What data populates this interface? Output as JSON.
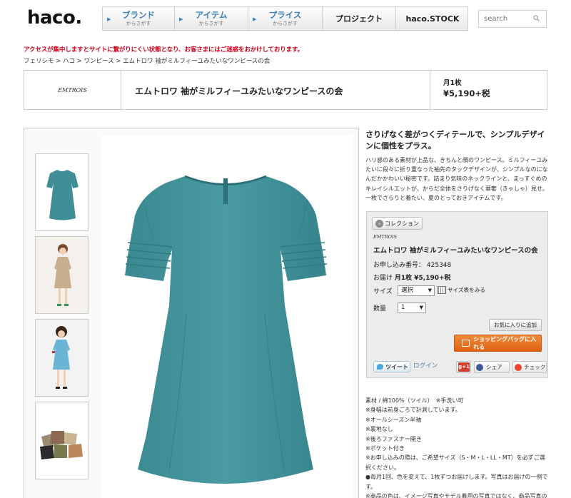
{
  "header": {
    "logo": "haco.",
    "nav": [
      {
        "label": "ブランド",
        "sub": "からさがす"
      },
      {
        "label": "アイテム",
        "sub": "からさがす"
      },
      {
        "label": "プライス",
        "sub": "からさがす"
      },
      {
        "label": "プロジェクト",
        "sub": ""
      },
      {
        "label": "haco.STOCK",
        "sub": ""
      }
    ],
    "search_placeholder": "search"
  },
  "notice": "アクセスが集中しますとサイトに繋がりにくい状態となり、お客さまにはご迷惑をおかけしております。",
  "breadcrumb": "フェリシモ > ハコ > ワンピース > エムトロワ 袖がミルフィーユみたいなワンピースの会",
  "product": {
    "brand": "EMTROIS",
    "name": "エムトロワ 袖がミルフィーユみたいなワンピースの会",
    "frequency": "月1枚",
    "price": "¥5,190+税"
  },
  "catch_copy": "さりげなく差がつくディテールで、シンプルデザインに個性をプラス。",
  "description": "ハリ感のある素材が上品な、きちんと顔のワンピース。ミルフィーユみたいに段々に折り重なった袖先のタックデザインが、シンプルなのになんだかかわいい秘密です。詰まり気味のネックラインと、まっすぐめのキレイシルエットが、からだ全体をさりげなく華奢（きゃしゃ）見せ。一枚でさらりと着たい、夏のとっておきアイテムです。",
  "cart": {
    "collection_label": "コレクション",
    "brand": "EMTROIS",
    "name": "エムトロワ 袖がミルフィーユみたいなワンピースの会",
    "order_no_label": "お申し込み番号：",
    "order_no": "425348",
    "delivery_label": "お届け",
    "delivery_value": "月1枚 ¥5,190+税",
    "size_label": "サイズ",
    "size_value": "選択",
    "size_guide": "サイズ表をみる",
    "qty_label": "数量",
    "qty_value": "1",
    "fav_button": "お気に入りに追加",
    "cart_button": "ショッピングバッグに入れる",
    "tweet": "ツイート",
    "login": "ログイン",
    "gplus": "g+1",
    "share": "シェア",
    "check": "チェック"
  },
  "specs": [
    "素材 / 綿100%（ツイル）　※手洗い可",
    "※身幅は前身ごろで計測しています。",
    "※オールシーズン半袖",
    "※裏地なし",
    "※後ろファスナー開き",
    "※ポケット付き",
    "※お申し込みの際は、ご希望サイズ（S・M・L・LL・MT）を必ずご選択ください。",
    "●毎月1回、色を変えて、1枚ずつお届けします。写真はお届けの一例です。",
    "※商品の色は、イメージ写真やモデル着用の写真ではなく、商品写真の"
  ],
  "colors": {
    "nav_text": "#3d7fb8",
    "notice": "#d0021b",
    "cart_button": "#e8741f",
    "dress": "#3f8e95"
  }
}
